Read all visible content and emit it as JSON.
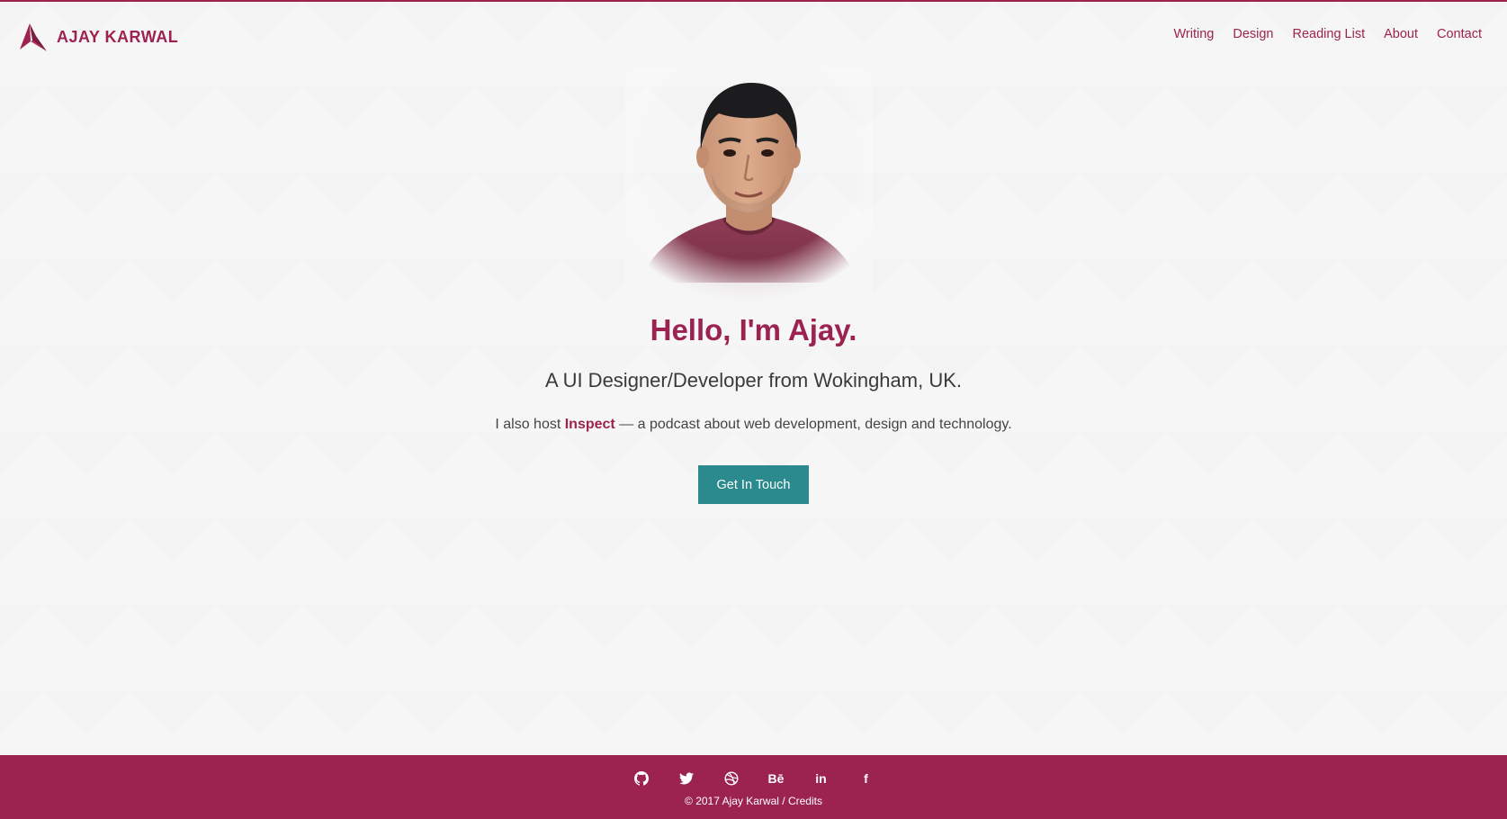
{
  "brand": {
    "name": "AJAY KARWAL",
    "color": "#9c2350"
  },
  "nav": {
    "items": [
      {
        "label": "Writing"
      },
      {
        "label": "Design"
      },
      {
        "label": "Reading List"
      },
      {
        "label": "About"
      },
      {
        "label": "Contact"
      }
    ]
  },
  "hero": {
    "headline": "Hello, I'm Ajay.",
    "subhead": "A UI Designer/Developer from Wokingham, UK.",
    "podcast_prefix": "I also host ",
    "podcast_link": "Inspect",
    "podcast_suffix": " — a podcast about web development, design and technology.",
    "cta_label": "Get In Touch",
    "cta_color": "#2a8a8d"
  },
  "footer": {
    "background": "#9c2350",
    "social": [
      {
        "icon": "github-icon"
      },
      {
        "icon": "twitter-icon"
      },
      {
        "icon": "dribbble-icon"
      },
      {
        "icon": "behance-icon",
        "label": "Bē"
      },
      {
        "icon": "linkedin-icon",
        "label": "in"
      },
      {
        "icon": "facebook-icon",
        "label": "f"
      }
    ],
    "copyright": "© 2017 Ajay Karwal",
    "separator": " / ",
    "credits": "Credits"
  }
}
